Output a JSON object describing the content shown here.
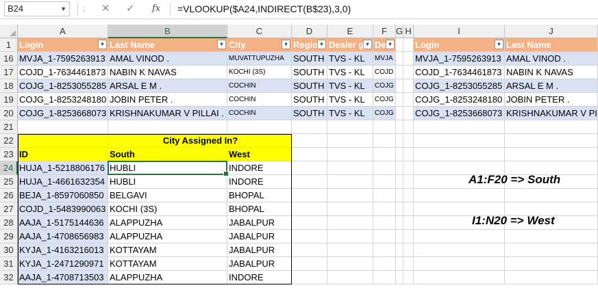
{
  "formula_bar": {
    "name_box": "B24",
    "fx_label": "fx",
    "formula": "=VLOOKUP($A24,INDIRECT(B$23),3,0)"
  },
  "columns": [
    "A",
    "B",
    "C",
    "D",
    "E",
    "F",
    "G",
    "H",
    "I",
    "J"
  ],
  "header_row": {
    "row": "1",
    "left": [
      "Login",
      "Last Name",
      "City",
      "Regio",
      "Dealer gr",
      "De"
    ],
    "right": [
      "Login",
      "Last Name"
    ]
  },
  "data_rows": [
    {
      "row": "16",
      "login": "MVJA_1-7595263913",
      "name": "AMAL VINOD .",
      "city": "MUVATTUPUZHA",
      "region": "SOUTH",
      "dealer": "TVS - KL",
      "de": "MVJA"
    },
    {
      "row": "17",
      "login": "COJD_1-7634461873",
      "name": "NABIN K NAVAS",
      "city": "KOCHI (3S)",
      "region": "SOUTH",
      "dealer": "TVS - KL",
      "de": "COJD"
    },
    {
      "row": "18",
      "login": "COJG_1-8253055285",
      "name": "ARSAL E M .",
      "city": "COCHIN",
      "region": "SOUTH",
      "dealer": "TVS - KL",
      "de": "COJG"
    },
    {
      "row": "19",
      "login": "COJG_1-8253248180",
      "name": "JOBIN PETER .",
      "city": "COCHIN",
      "region": "SOUTH",
      "dealer": "TVS - KL",
      "de": "COJG"
    },
    {
      "row": "20",
      "login": "COJG_1-8253668073",
      "name": "KRISHNAKUMAR V PILLAI .",
      "city": "COCHIN",
      "region": "SOUTH",
      "dealer": "TVS - KL",
      "de": "COJG"
    }
  ],
  "empty_row": "21",
  "lookup_table": {
    "title_row": "22",
    "title": "City Assigned In?",
    "header_row": "23",
    "headers": [
      "ID",
      "South",
      "West"
    ],
    "rows": [
      {
        "row": "24",
        "id": "HUJA_1-5218806176",
        "south": "HUBLI",
        "west": "INDORE"
      },
      {
        "row": "25",
        "id": "HUJA_1-4661632354",
        "south": "HUBLI",
        "west": "INDORE"
      },
      {
        "row": "26",
        "id": "BEJA_1-8597060850",
        "south": "BELGAVI",
        "west": "BHOPAL"
      },
      {
        "row": "27",
        "id": "COJD_1-5483990063",
        "south": "KOCHI (3S)",
        "west": "BHOPAL"
      },
      {
        "row": "28",
        "id": "AAJA_1-5175144636",
        "south": "ALAPPUZHA",
        "west": "JABALPUR"
      },
      {
        "row": "29",
        "id": "AAJA_1-4708656983",
        "south": "ALAPPUZHA",
        "west": "JABALPUR"
      },
      {
        "row": "30",
        "id": "KYJA_1-4163216013",
        "south": "KOTTAYAM",
        "west": "JABALPUR"
      },
      {
        "row": "31",
        "id": "KYJA_1-2471290971",
        "south": "KOTTAYAM",
        "west": "JABALPUR"
      },
      {
        "row": "32",
        "id": "AAJA_1-4708713503",
        "south": "ALAPPUZHA",
        "west": "INDORE"
      }
    ]
  },
  "annotations": {
    "south": "A1:F20 => South",
    "west": "I1:N20 => West"
  },
  "colors": {
    "header_fill": "#f4b183",
    "band_fill": "#dae1f2",
    "title_fill": "#ffff00",
    "selection": "#217346"
  }
}
